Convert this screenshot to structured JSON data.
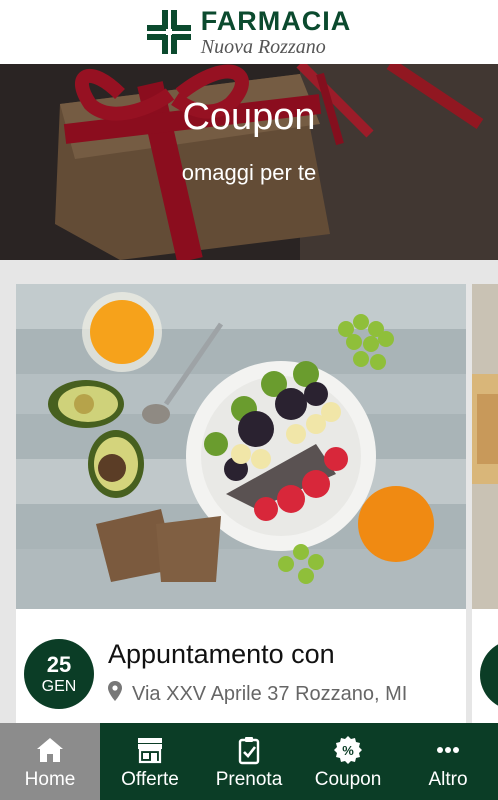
{
  "header": {
    "brand_title": "FARMACIA",
    "brand_subtitle": "Nuova Rozzano",
    "brand_color": "#0b4a2e"
  },
  "hero": {
    "title": "Coupon",
    "subtitle": "omaggi per te"
  },
  "cards": [
    {
      "day": "25",
      "month": "GEN",
      "title": "Appuntamento con",
      "address": "Via XXV Aprile 37 Rozzano, MI",
      "location_icon": "location-pin-icon"
    }
  ],
  "bottom_nav": {
    "items": [
      {
        "label": "Home",
        "icon": "home-icon",
        "active": true
      },
      {
        "label": "Offerte",
        "icon": "store-icon",
        "active": false
      },
      {
        "label": "Prenota",
        "icon": "clipboard-check-icon",
        "active": false
      },
      {
        "label": "Coupon",
        "icon": "percent-badge-icon",
        "active": false
      },
      {
        "label": "Altro",
        "icon": "more-dots-icon",
        "active": false
      }
    ],
    "background": "#0b3d26",
    "active_background": "#8c8c8c"
  }
}
